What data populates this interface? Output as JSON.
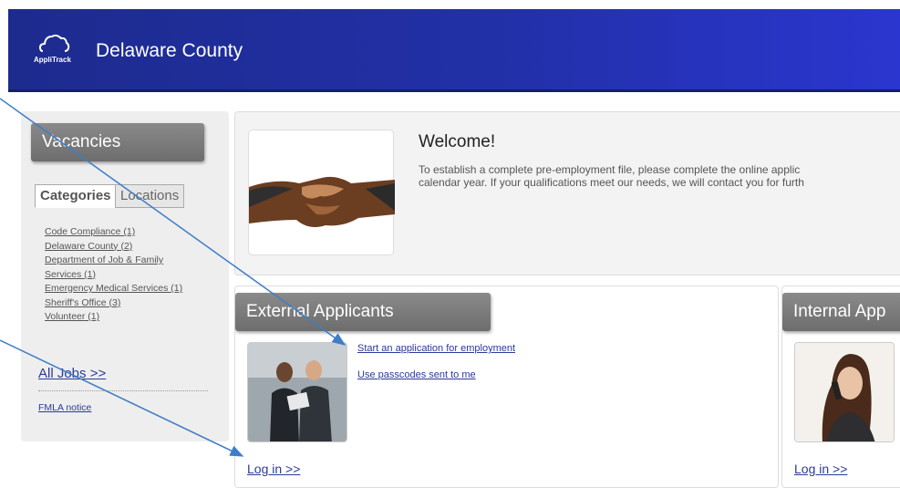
{
  "header": {
    "logo_text": "AppliTrack",
    "org_name": "Delaware County"
  },
  "sidebar": {
    "title": "Vacancies",
    "tabs": [
      {
        "label": "Categories",
        "active": true
      },
      {
        "label": "Locations",
        "active": false
      }
    ],
    "categories": [
      "Code Compliance (1)",
      "Delaware County (2)",
      "Department of Job & Family",
      "Services (1)",
      "Emergency Medical Services (1)",
      "Sheriff's Office (3)",
      "Volunteer (1)"
    ],
    "all_jobs": "All Jobs >>",
    "fmla": "FMLA notice"
  },
  "welcome": {
    "title": "Welcome!",
    "line1": "To establish a complete pre-employment file, please complete the online applic",
    "line2": "calendar year. If your qualifications meet our needs, we will contact you for furth"
  },
  "external": {
    "title": "External Applicants",
    "links": [
      "Start an application for employment",
      "Use passcodes sent to me"
    ],
    "login": "Log in >>"
  },
  "internal": {
    "title": "Internal App",
    "login": "Log in >>"
  },
  "colors": {
    "header": "#2230a8",
    "link": "#2b3a9a",
    "annotation_arrow": "#3f7dc7"
  }
}
